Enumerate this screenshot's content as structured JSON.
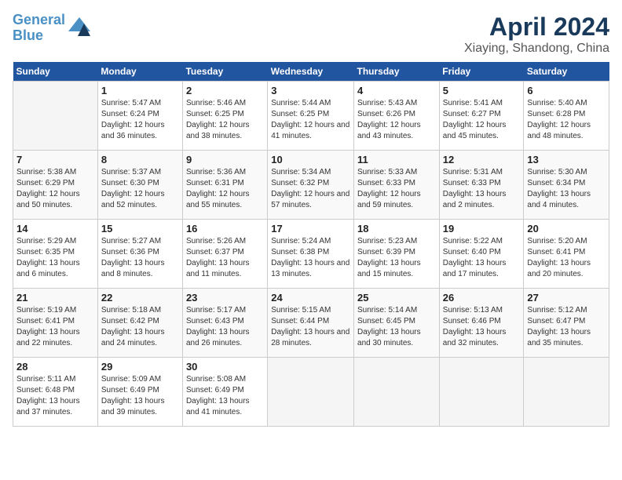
{
  "header": {
    "logo_line1": "General",
    "logo_line2": "Blue",
    "title": "April 2024",
    "subtitle": "Xiaying, Shandong, China"
  },
  "days_of_week": [
    "Sunday",
    "Monday",
    "Tuesday",
    "Wednesday",
    "Thursday",
    "Friday",
    "Saturday"
  ],
  "weeks": [
    [
      {
        "day": "",
        "empty": true
      },
      {
        "day": "1",
        "sunrise": "5:47 AM",
        "sunset": "6:24 PM",
        "daylight": "12 hours and 36 minutes."
      },
      {
        "day": "2",
        "sunrise": "5:46 AM",
        "sunset": "6:25 PM",
        "daylight": "12 hours and 38 minutes."
      },
      {
        "day": "3",
        "sunrise": "5:44 AM",
        "sunset": "6:25 PM",
        "daylight": "12 hours and 41 minutes."
      },
      {
        "day": "4",
        "sunrise": "5:43 AM",
        "sunset": "6:26 PM",
        "daylight": "12 hours and 43 minutes."
      },
      {
        "day": "5",
        "sunrise": "5:41 AM",
        "sunset": "6:27 PM",
        "daylight": "12 hours and 45 minutes."
      },
      {
        "day": "6",
        "sunrise": "5:40 AM",
        "sunset": "6:28 PM",
        "daylight": "12 hours and 48 minutes."
      }
    ],
    [
      {
        "day": "7",
        "sunrise": "5:38 AM",
        "sunset": "6:29 PM",
        "daylight": "12 hours and 50 minutes."
      },
      {
        "day": "8",
        "sunrise": "5:37 AM",
        "sunset": "6:30 PM",
        "daylight": "12 hours and 52 minutes."
      },
      {
        "day": "9",
        "sunrise": "5:36 AM",
        "sunset": "6:31 PM",
        "daylight": "12 hours and 55 minutes."
      },
      {
        "day": "10",
        "sunrise": "5:34 AM",
        "sunset": "6:32 PM",
        "daylight": "12 hours and 57 minutes."
      },
      {
        "day": "11",
        "sunrise": "5:33 AM",
        "sunset": "6:33 PM",
        "daylight": "12 hours and 59 minutes."
      },
      {
        "day": "12",
        "sunrise": "5:31 AM",
        "sunset": "6:33 PM",
        "daylight": "13 hours and 2 minutes."
      },
      {
        "day": "13",
        "sunrise": "5:30 AM",
        "sunset": "6:34 PM",
        "daylight": "13 hours and 4 minutes."
      }
    ],
    [
      {
        "day": "14",
        "sunrise": "5:29 AM",
        "sunset": "6:35 PM",
        "daylight": "13 hours and 6 minutes."
      },
      {
        "day": "15",
        "sunrise": "5:27 AM",
        "sunset": "6:36 PM",
        "daylight": "13 hours and 8 minutes."
      },
      {
        "day": "16",
        "sunrise": "5:26 AM",
        "sunset": "6:37 PM",
        "daylight": "13 hours and 11 minutes."
      },
      {
        "day": "17",
        "sunrise": "5:24 AM",
        "sunset": "6:38 PM",
        "daylight": "13 hours and 13 minutes."
      },
      {
        "day": "18",
        "sunrise": "5:23 AM",
        "sunset": "6:39 PM",
        "daylight": "13 hours and 15 minutes."
      },
      {
        "day": "19",
        "sunrise": "5:22 AM",
        "sunset": "6:40 PM",
        "daylight": "13 hours and 17 minutes."
      },
      {
        "day": "20",
        "sunrise": "5:20 AM",
        "sunset": "6:41 PM",
        "daylight": "13 hours and 20 minutes."
      }
    ],
    [
      {
        "day": "21",
        "sunrise": "5:19 AM",
        "sunset": "6:41 PM",
        "daylight": "13 hours and 22 minutes."
      },
      {
        "day": "22",
        "sunrise": "5:18 AM",
        "sunset": "6:42 PM",
        "daylight": "13 hours and 24 minutes."
      },
      {
        "day": "23",
        "sunrise": "5:17 AM",
        "sunset": "6:43 PM",
        "daylight": "13 hours and 26 minutes."
      },
      {
        "day": "24",
        "sunrise": "5:15 AM",
        "sunset": "6:44 PM",
        "daylight": "13 hours and 28 minutes."
      },
      {
        "day": "25",
        "sunrise": "5:14 AM",
        "sunset": "6:45 PM",
        "daylight": "13 hours and 30 minutes."
      },
      {
        "day": "26",
        "sunrise": "5:13 AM",
        "sunset": "6:46 PM",
        "daylight": "13 hours and 32 minutes."
      },
      {
        "day": "27",
        "sunrise": "5:12 AM",
        "sunset": "6:47 PM",
        "daylight": "13 hours and 35 minutes."
      }
    ],
    [
      {
        "day": "28",
        "sunrise": "5:11 AM",
        "sunset": "6:48 PM",
        "daylight": "13 hours and 37 minutes."
      },
      {
        "day": "29",
        "sunrise": "5:09 AM",
        "sunset": "6:49 PM",
        "daylight": "13 hours and 39 minutes."
      },
      {
        "day": "30",
        "sunrise": "5:08 AM",
        "sunset": "6:49 PM",
        "daylight": "13 hours and 41 minutes."
      },
      {
        "day": "",
        "empty": true
      },
      {
        "day": "",
        "empty": true
      },
      {
        "day": "",
        "empty": true
      },
      {
        "day": "",
        "empty": true
      }
    ]
  ]
}
